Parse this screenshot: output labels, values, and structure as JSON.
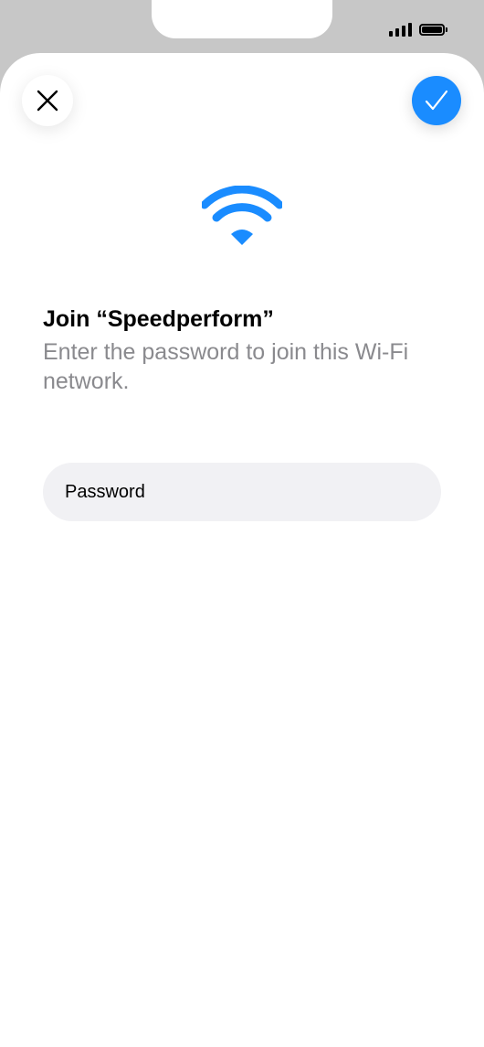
{
  "status_bar": {
    "signal_icon": "cellular-signal-icon",
    "battery_icon": "battery-full-icon"
  },
  "header": {
    "close_icon": "close-icon",
    "confirm_icon": "checkmark-icon",
    "confirm_color": "#1a8cff"
  },
  "network": {
    "icon": "wifi-icon",
    "icon_color": "#1a8cff",
    "title": "Join “Speedperform”",
    "subtitle": "Enter the password to join this Wi-Fi network."
  },
  "password": {
    "value": "",
    "placeholder": "Password"
  }
}
